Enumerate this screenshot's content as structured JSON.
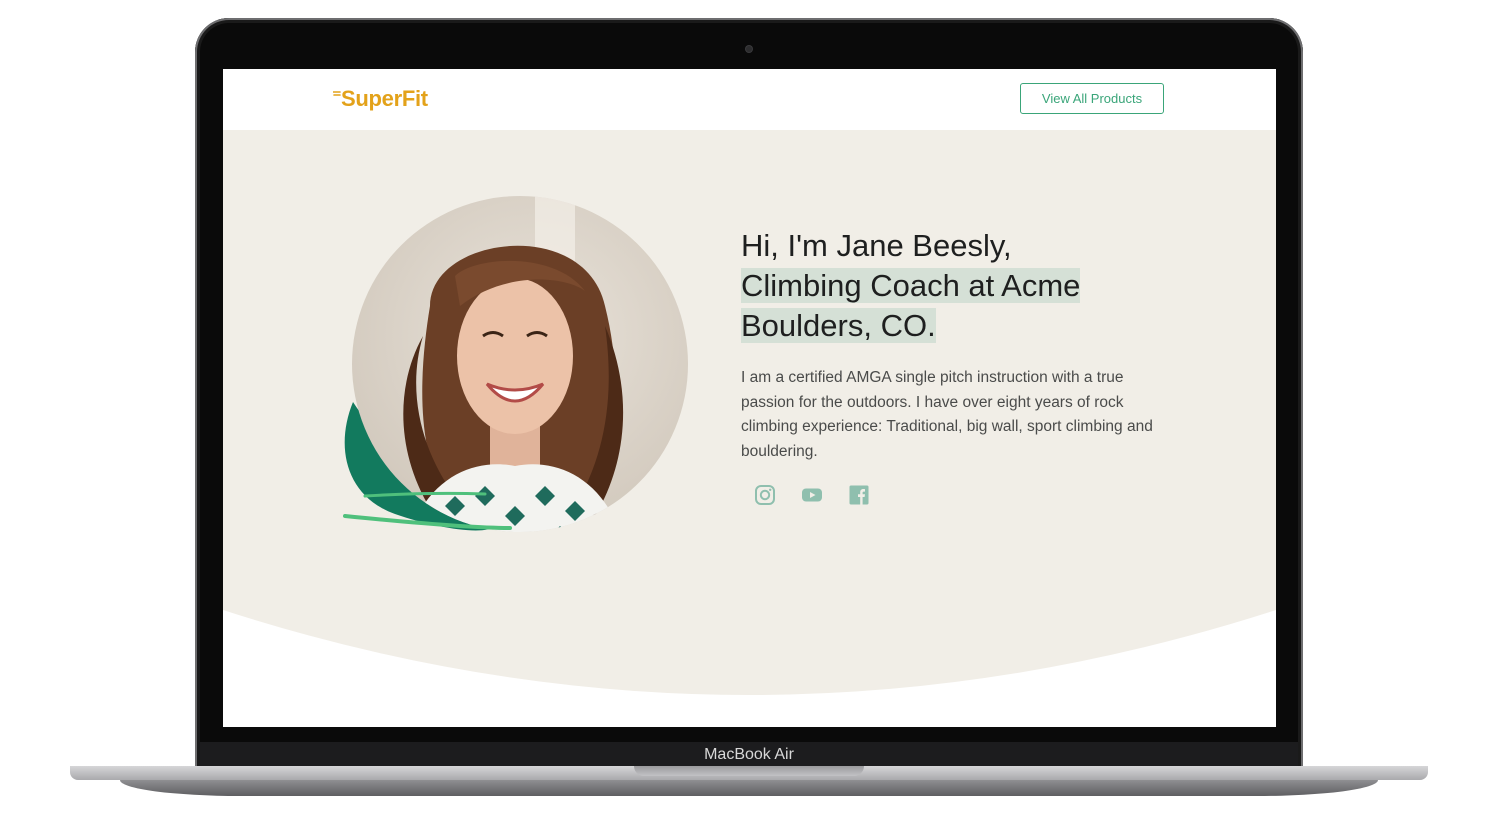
{
  "device": {
    "model_label": "MacBook Air"
  },
  "navbar": {
    "brand": "SuperFit",
    "products_button_label": "View All Products"
  },
  "hero": {
    "greeting": "Hi, I'm Jane Beesly,",
    "title_highlight": "Climbing Coach at Acme Boulders, CO.",
    "bio": "I am a certified AMGA single pitch instruction with a true passion for the outdoors. I have over eight years of rock climbing experience: Traditional, big wall, sport climbing and bouldering.",
    "socials": [
      {
        "icon": "instagram-icon"
      },
      {
        "icon": "youtube-icon"
      },
      {
        "icon": "facebook-icon"
      }
    ]
  },
  "colors": {
    "brand": "#e3a21a",
    "accent_green": "#3aa579",
    "hero_bg": "#f1eee7",
    "highlight_bg": "#d5e0d6",
    "leaf_green": "#127a5e",
    "social_icon": "#8fbfae"
  }
}
